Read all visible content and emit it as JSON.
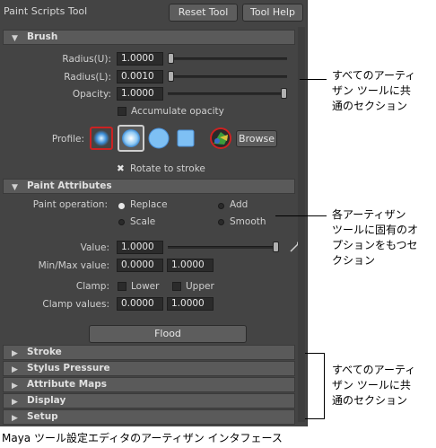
{
  "window": {
    "title": "Paint Scripts Tool",
    "reset_label": "Reset Tool",
    "help_label": "Tool Help"
  },
  "brush": {
    "header": "Brush",
    "radius_u_label": "Radius(U):",
    "radius_u_value": "1.0000",
    "radius_l_label": "Radius(L):",
    "radius_l_value": "0.0010",
    "opacity_label": "Opacity:",
    "opacity_value": "1.0000",
    "accumulate_label": "Accumulate opacity",
    "profile_label": "Profile:",
    "browse_label": "Browse",
    "rotate_label": "Rotate to stroke",
    "rotate_mark": "✖"
  },
  "paint_attributes": {
    "header": "Paint Attributes",
    "operation_label": "Paint operation:",
    "op_replace": "Replace",
    "op_add": "Add",
    "op_scale": "Scale",
    "op_smooth": "Smooth",
    "value_label": "Value:",
    "value_value": "1.0000",
    "minmax_label": "Min/Max value:",
    "min_value": "0.0000",
    "max_value": "1.0000",
    "clamp_label": "Clamp:",
    "clamp_lower": "Lower",
    "clamp_upper": "Upper",
    "clamp_values_label": "Clamp values:",
    "clamp_min": "0.0000",
    "clamp_max": "1.0000",
    "flood_label": "Flood"
  },
  "collapsed_sections": {
    "stroke": "Stroke",
    "stylus": "Stylus Pressure",
    "attribute_maps": "Attribute Maps",
    "display": "Display",
    "setup": "Setup"
  },
  "arrows": {
    "open": "▼",
    "closed": "▶"
  },
  "annotations": {
    "top": "すべてのアーティ\nザン ツールに共\n通のセクション",
    "middle": "各アーティザン\nツールに固有のオ\nプションをもつセ\nクション",
    "bottom": "すべてのアーティ\nザン ツールに共\n通のセクション"
  },
  "caption": "Maya ツール設定エディタのアーティザン インタフェース"
}
